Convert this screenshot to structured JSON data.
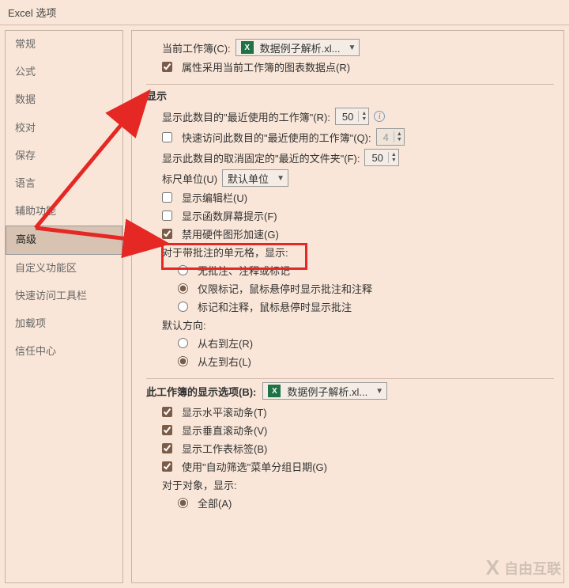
{
  "title": "Excel 选项",
  "sidebar": {
    "items": [
      "常规",
      "公式",
      "数据",
      "校对",
      "保存",
      "语言",
      "辅助功能",
      "高级",
      "自定义功能区",
      "快速访问工具栏",
      "加载项",
      "信任中心"
    ],
    "selectedIndex": 7
  },
  "top": {
    "currentWorkbookLabel": "当前工作簿(C):",
    "currentWorkbookValue": "数据例子解析.xl...",
    "attrUseCurrent": "属性采用当前工作簿的图表数据点(R)"
  },
  "display": {
    "head": "显示",
    "recentWorkbooksLabel": "显示此数目的\"最近使用的工作簿\"(R):",
    "recentWorkbooksValue": "50",
    "quickAccessRecentLabel": "快速访问此数目的\"最近使用的工作簿\"(Q):",
    "quickAccessRecentValue": "4",
    "recentFoldersLabel": "显示此数目的取消固定的\"最近的文件夹\"(F):",
    "recentFoldersValue": "50",
    "rulerUnitsLabel": "标尺单位(U)",
    "rulerUnitsValue": "默认单位",
    "showEditBar": "显示编辑栏(U)",
    "showFuncTip": "显示函数屏幕提示(F)",
    "disableHwAccel": "禁用硬件图形加速(G)",
    "commentsHead": "对于带批注的单元格，显示:",
    "commentNone": "无批注、注释或标记",
    "commentMarkOnly": "仅限标记，鼠标悬停时显示批注和注释",
    "commentBoth": "标记和注释，鼠标悬停时显示批注",
    "defaultDirHead": "默认方向:",
    "dirRTL": "从右到左(R)",
    "dirLTR": "从左到右(L)"
  },
  "wb": {
    "head": "此工作簿的显示选项(B):",
    "value": "数据例子解析.xl...",
    "hscroll": "显示水平滚动条(T)",
    "vscroll": "显示垂直滚动条(V)",
    "sheetTabs": "显示工作表标签(B)",
    "autoFilterDate": "使用\"自动筛选\"菜单分组日期(G)",
    "objectsHead": "对于对象，显示:",
    "objectsAll": "全部(A)"
  },
  "watermark": "自由互联"
}
